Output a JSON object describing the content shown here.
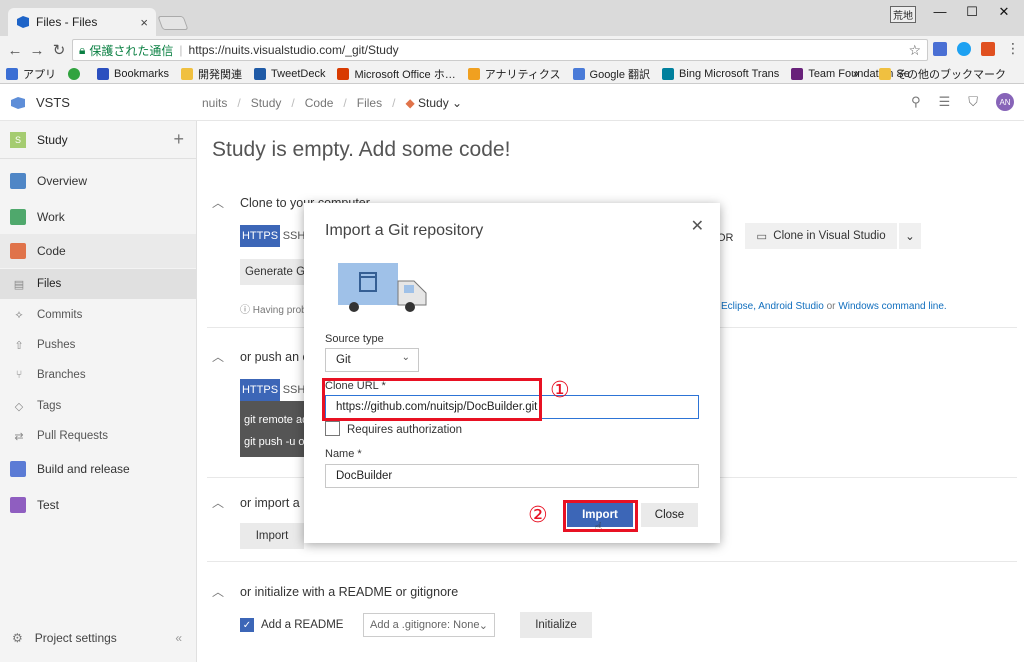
{
  "browser": {
    "tab_title": "Files - Files",
    "tab_close": "×",
    "user_badge": "荒地",
    "window_controls": [
      "—",
      "☐",
      "✕"
    ],
    "security_label": "保護された通信",
    "url": "https://nuits.visualstudio.com/_git/Study",
    "bookmarks": [
      {
        "label": "アプリ",
        "color": "#3b6fd4"
      },
      {
        "label": "",
        "color": "#31a33f"
      },
      {
        "label": "Bookmarks",
        "color": "#2b4fbf"
      },
      {
        "label": "開発関連",
        "color": "#f0c040"
      },
      {
        "label": "TweetDeck",
        "color": "#1f5aa6"
      },
      {
        "label": "Microsoft Office ホ…",
        "color": "#d83b01"
      },
      {
        "label": "アナリティクス",
        "color": "#f0a020"
      },
      {
        "label": "Google 翻訳",
        "color": "#4a7bd8"
      },
      {
        "label": "Bing Microsoft Trans",
        "color": "#00809d"
      },
      {
        "label": "Team Foundation Se",
        "color": "#68217a"
      }
    ],
    "bookmarks_overflow": "»",
    "other_bookmarks": "その他のブックマーク"
  },
  "app": {
    "name": "VSTS",
    "breadcrumb": [
      "nuits",
      "Study",
      "Code",
      "Files",
      "Study"
    ],
    "avatar_initials": "AN"
  },
  "sidebar": {
    "project": {
      "badge": "S",
      "name": "Study"
    },
    "items": [
      {
        "label": "Overview",
        "color": "#4f86c6"
      },
      {
        "label": "Work",
        "color": "#4fa86c"
      },
      {
        "label": "Code",
        "color": "#e0734a"
      },
      {
        "label": "Files",
        "icon": "▤"
      },
      {
        "label": "Commits",
        "icon": "⟡"
      },
      {
        "label": "Pushes",
        "icon": "⇧"
      },
      {
        "label": "Branches",
        "icon": "⑂"
      },
      {
        "label": "Tags",
        "icon": "◇"
      },
      {
        "label": "Pull Requests",
        "icon": "⇄"
      },
      {
        "label": "Build and release",
        "color": "#5b7bd5"
      },
      {
        "label": "Test",
        "color": "#8f5ec0"
      }
    ],
    "settings_label": "Project settings"
  },
  "main": {
    "title": "Study is empty. Add some code!",
    "sections": {
      "clone": "Clone to your computer",
      "push": "or push an e",
      "import": "or import a",
      "init": "or initialize with a README or gitignore"
    },
    "https": "HTTPS",
    "ssh": "SSH",
    "or_suffix": "OR",
    "clone_vs": "Clone in Visual Studio",
    "generate": "Generate G",
    "having_problems": "Having prob",
    "help_links": "Eclipse, Android Studio",
    "help_or": "or",
    "help_windows": "Windows command line.",
    "code_lines": [
      "git remote ad",
      "git push -u o"
    ],
    "import_btn": "Import",
    "add_readme": "Add a README",
    "gitignore": "Add a .gitignore: None",
    "initialize": "Initialize"
  },
  "dialog": {
    "title": "Import a Git repository",
    "source_type_label": "Source type",
    "source_type_value": "Git",
    "clone_url_label": "Clone URL *",
    "clone_url_value": "https://github.com/nuitsjp/DocBuilder.git",
    "requires_auth": "Requires authorization",
    "name_label": "Name *",
    "name_value": "DocBuilder",
    "import": "Import",
    "close": "Close"
  },
  "annotations": {
    "one": "①",
    "two": "②",
    "highlight_color": "#e81123"
  }
}
